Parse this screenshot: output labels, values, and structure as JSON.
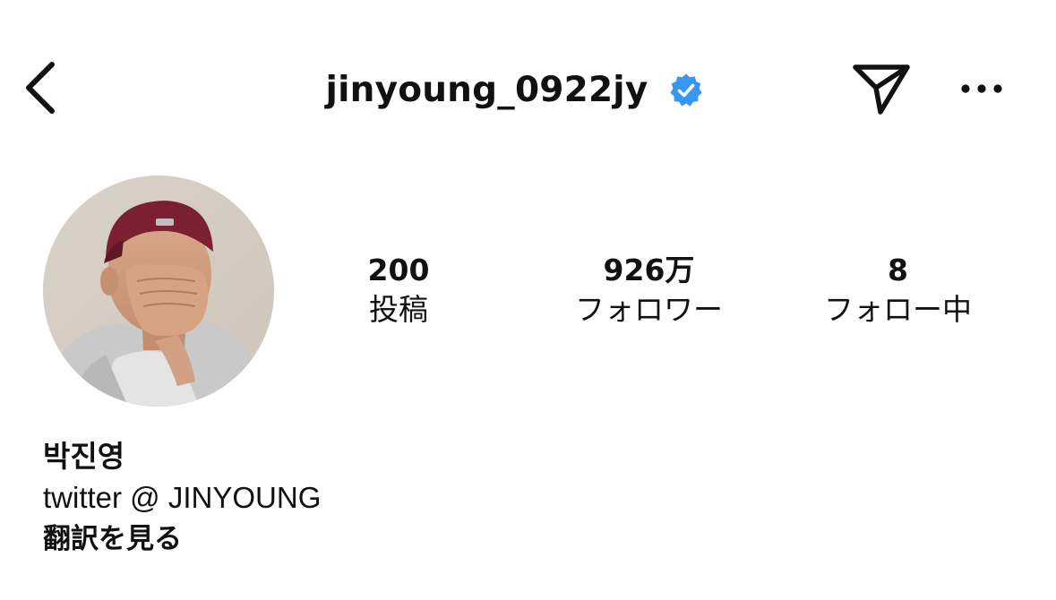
{
  "header": {
    "username": "jinyoung_0922jy",
    "verified": true,
    "verified_color": "#3897F0",
    "back_icon": "chevron-left-icon",
    "send_icon": "paper-plane-icon",
    "more_icon": "more-horizontal-icon"
  },
  "profile": {
    "avatar_icon": "profile-photo"
  },
  "stats": [
    {
      "value": "200",
      "label": "投稿"
    },
    {
      "value": "926万",
      "label": "フォロワー"
    },
    {
      "value": "8",
      "label": "フォロー中"
    }
  ],
  "bio": {
    "name": "박진영",
    "line": "twitter @ JINYOUNG",
    "translate_label": "翻訳を見る"
  }
}
